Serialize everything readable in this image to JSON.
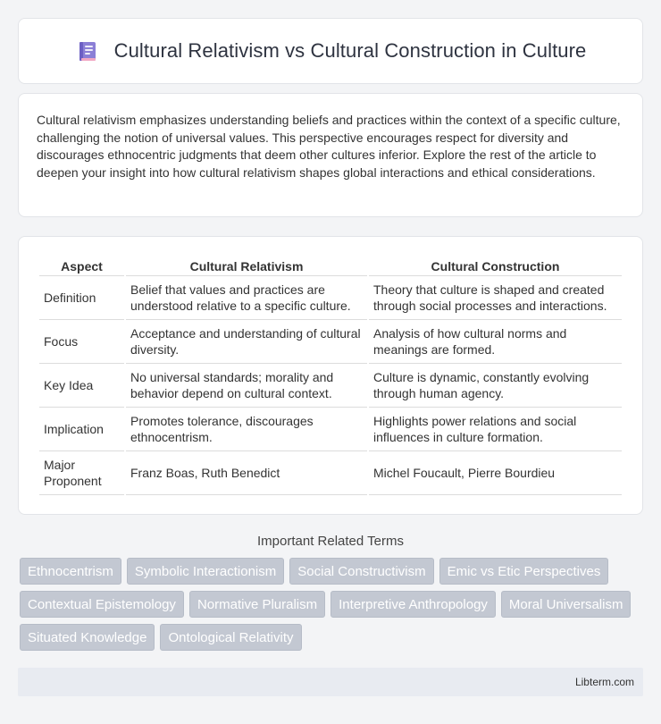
{
  "header": {
    "title": "Cultural Relativism vs Cultural Construction in Culture",
    "icon": "book-icon"
  },
  "intro": {
    "text": "Cultural relativism emphasizes understanding beliefs and practices within the context of a specific culture, challenging the notion of universal values. This perspective encourages respect for diversity and discourages ethnocentric judgments that deem other cultures inferior. Explore the rest of the article to deepen your insight into how cultural relativism shapes global interactions and ethical considerations."
  },
  "table": {
    "headers": [
      "Aspect",
      "Cultural Relativism",
      "Cultural Construction"
    ],
    "rows": [
      [
        "Definition",
        "Belief that values and practices are understood relative to a specific culture.",
        "Theory that culture is shaped and created through social processes and interactions."
      ],
      [
        "Focus",
        "Acceptance and understanding of cultural diversity.",
        "Analysis of how cultural norms and meanings are formed."
      ],
      [
        "Key Idea",
        "No universal standards; morality and behavior depend on cultural context.",
        "Culture is dynamic, constantly evolving through human agency."
      ],
      [
        "Implication",
        "Promotes tolerance, discourages ethnocentrism.",
        "Highlights power relations and social influences in culture formation."
      ],
      [
        "Major Proponent",
        "Franz Boas, Ruth Benedict",
        "Michel Foucault, Pierre Bourdieu"
      ]
    ]
  },
  "terms": {
    "title": "Important Related Terms",
    "items": [
      "Ethnocentrism",
      "Symbolic Interactionism",
      "Social Constructivism",
      "Emic vs Etic Perspectives",
      "Contextual Epistemology",
      "Normative Pluralism",
      "Interpretive Anthropology",
      "Moral Universalism",
      "Situated Knowledge",
      "Ontological Relativity"
    ]
  },
  "footer": {
    "text": "Libterm.com"
  },
  "colors": {
    "tag_bg": "#c3c8d2",
    "footer_bg": "#e8ebf1",
    "page_bg": "#f3f4f6"
  }
}
